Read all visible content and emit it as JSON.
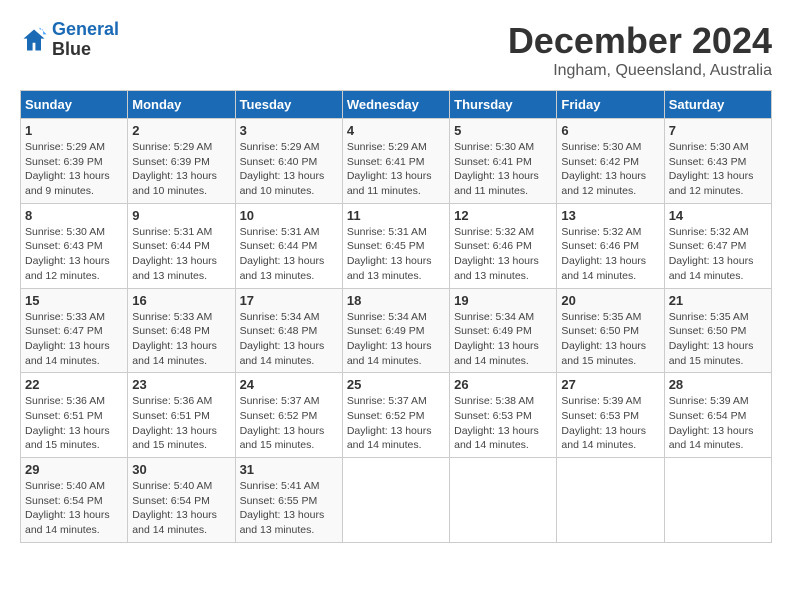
{
  "logo": {
    "line1": "General",
    "line2": "Blue"
  },
  "title": "December 2024",
  "location": "Ingham, Queensland, Australia",
  "days_of_week": [
    "Sunday",
    "Monday",
    "Tuesday",
    "Wednesday",
    "Thursday",
    "Friday",
    "Saturday"
  ],
  "weeks": [
    [
      {
        "day": "1",
        "sunrise": "5:29 AM",
        "sunset": "6:39 PM",
        "daylight": "13 hours and 9 minutes."
      },
      {
        "day": "2",
        "sunrise": "5:29 AM",
        "sunset": "6:39 PM",
        "daylight": "13 hours and 10 minutes."
      },
      {
        "day": "3",
        "sunrise": "5:29 AM",
        "sunset": "6:40 PM",
        "daylight": "13 hours and 10 minutes."
      },
      {
        "day": "4",
        "sunrise": "5:29 AM",
        "sunset": "6:41 PM",
        "daylight": "13 hours and 11 minutes."
      },
      {
        "day": "5",
        "sunrise": "5:30 AM",
        "sunset": "6:41 PM",
        "daylight": "13 hours and 11 minutes."
      },
      {
        "day": "6",
        "sunrise": "5:30 AM",
        "sunset": "6:42 PM",
        "daylight": "13 hours and 12 minutes."
      },
      {
        "day": "7",
        "sunrise": "5:30 AM",
        "sunset": "6:43 PM",
        "daylight": "13 hours and 12 minutes."
      }
    ],
    [
      {
        "day": "8",
        "sunrise": "5:30 AM",
        "sunset": "6:43 PM",
        "daylight": "13 hours and 12 minutes."
      },
      {
        "day": "9",
        "sunrise": "5:31 AM",
        "sunset": "6:44 PM",
        "daylight": "13 hours and 13 minutes."
      },
      {
        "day": "10",
        "sunrise": "5:31 AM",
        "sunset": "6:44 PM",
        "daylight": "13 hours and 13 minutes."
      },
      {
        "day": "11",
        "sunrise": "5:31 AM",
        "sunset": "6:45 PM",
        "daylight": "13 hours and 13 minutes."
      },
      {
        "day": "12",
        "sunrise": "5:32 AM",
        "sunset": "6:46 PM",
        "daylight": "13 hours and 13 minutes."
      },
      {
        "day": "13",
        "sunrise": "5:32 AM",
        "sunset": "6:46 PM",
        "daylight": "13 hours and 14 minutes."
      },
      {
        "day": "14",
        "sunrise": "5:32 AM",
        "sunset": "6:47 PM",
        "daylight": "13 hours and 14 minutes."
      }
    ],
    [
      {
        "day": "15",
        "sunrise": "5:33 AM",
        "sunset": "6:47 PM",
        "daylight": "13 hours and 14 minutes."
      },
      {
        "day": "16",
        "sunrise": "5:33 AM",
        "sunset": "6:48 PM",
        "daylight": "13 hours and 14 minutes."
      },
      {
        "day": "17",
        "sunrise": "5:34 AM",
        "sunset": "6:48 PM",
        "daylight": "13 hours and 14 minutes."
      },
      {
        "day": "18",
        "sunrise": "5:34 AM",
        "sunset": "6:49 PM",
        "daylight": "13 hours and 14 minutes."
      },
      {
        "day": "19",
        "sunrise": "5:34 AM",
        "sunset": "6:49 PM",
        "daylight": "13 hours and 14 minutes."
      },
      {
        "day": "20",
        "sunrise": "5:35 AM",
        "sunset": "6:50 PM",
        "daylight": "13 hours and 15 minutes."
      },
      {
        "day": "21",
        "sunrise": "5:35 AM",
        "sunset": "6:50 PM",
        "daylight": "13 hours and 15 minutes."
      }
    ],
    [
      {
        "day": "22",
        "sunrise": "5:36 AM",
        "sunset": "6:51 PM",
        "daylight": "13 hours and 15 minutes."
      },
      {
        "day": "23",
        "sunrise": "5:36 AM",
        "sunset": "6:51 PM",
        "daylight": "13 hours and 15 minutes."
      },
      {
        "day": "24",
        "sunrise": "5:37 AM",
        "sunset": "6:52 PM",
        "daylight": "13 hours and 15 minutes."
      },
      {
        "day": "25",
        "sunrise": "5:37 AM",
        "sunset": "6:52 PM",
        "daylight": "13 hours and 14 minutes."
      },
      {
        "day": "26",
        "sunrise": "5:38 AM",
        "sunset": "6:53 PM",
        "daylight": "13 hours and 14 minutes."
      },
      {
        "day": "27",
        "sunrise": "5:39 AM",
        "sunset": "6:53 PM",
        "daylight": "13 hours and 14 minutes."
      },
      {
        "day": "28",
        "sunrise": "5:39 AM",
        "sunset": "6:54 PM",
        "daylight": "13 hours and 14 minutes."
      }
    ],
    [
      {
        "day": "29",
        "sunrise": "5:40 AM",
        "sunset": "6:54 PM",
        "daylight": "13 hours and 14 minutes."
      },
      {
        "day": "30",
        "sunrise": "5:40 AM",
        "sunset": "6:54 PM",
        "daylight": "13 hours and 14 minutes."
      },
      {
        "day": "31",
        "sunrise": "5:41 AM",
        "sunset": "6:55 PM",
        "daylight": "13 hours and 13 minutes."
      },
      null,
      null,
      null,
      null
    ]
  ],
  "labels": {
    "sunrise": "Sunrise:",
    "sunset": "Sunset:",
    "daylight": "Daylight:"
  }
}
